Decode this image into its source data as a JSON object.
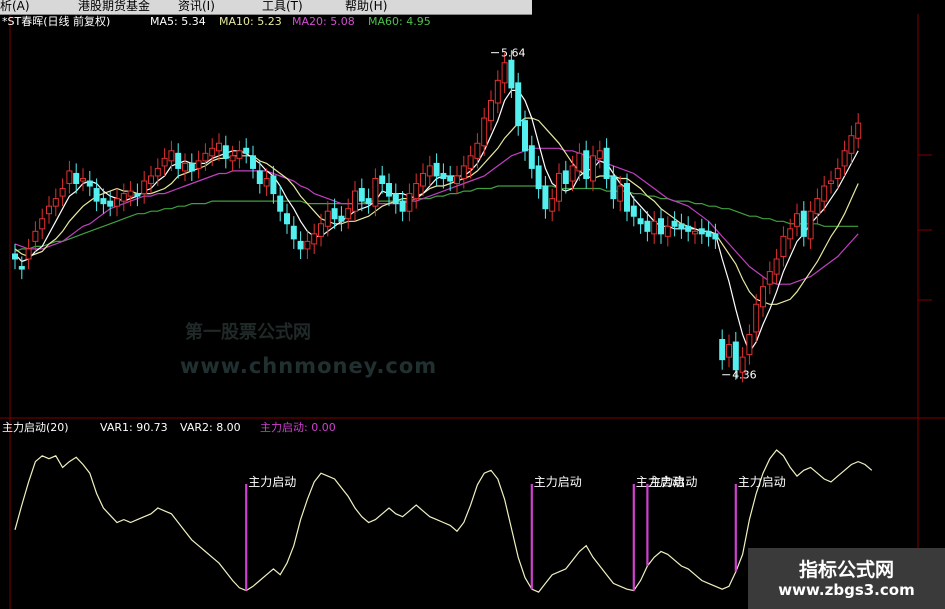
{
  "menu": {
    "items": [
      "析(A)",
      "港股期货基金",
      "资讯(I)",
      "工具(T)",
      "帮助(H)"
    ]
  },
  "header": {
    "stock": "*ST春晖(日线 前复权)",
    "ma5": "MA5: 5.34",
    "ma10": "MA10: 5.23",
    "ma20": "MA20: 5.08",
    "ma60": "MA60: 4.95"
  },
  "indicator_header": {
    "name": "主力启动(20)",
    "var1": "VAR1: 90.73",
    "var2": "VAR2: 8.00",
    "signal": "主力启动: 0.00"
  },
  "watermark": {
    "line1": "第一股票公式网",
    "line2": "www.chnmoney.com"
  },
  "badge": {
    "line1": "指标公式网",
    "line2": "www.zbgs3.com"
  },
  "colors": {
    "up": "#e03030",
    "down": "#54f0f0",
    "ma5": "#ffffff",
    "ma10": "#e8e8a0",
    "ma20": "#c040c0",
    "ma60": "#40a040",
    "signal": "#d040d0",
    "indicator_line": "#f0f0c0",
    "frame": "#800000"
  },
  "chart_data": [
    {
      "type": "candlestick",
      "title": "*ST春晖(日线 前复权)",
      "ylim": [
        4.2,
        5.75
      ],
      "annotations": [
        {
          "text": "5.64",
          "x_index": 70,
          "value": 5.64
        },
        {
          "text": "4.36",
          "x_index": 104,
          "value": 4.36
        }
      ],
      "series_ma": [
        {
          "name": "MA5",
          "last": 5.34
        },
        {
          "name": "MA10",
          "last": 5.23
        },
        {
          "name": "MA20",
          "last": 5.08
        },
        {
          "name": "MA60",
          "last": 4.95
        }
      ],
      "close": [
        4.82,
        4.78,
        4.86,
        4.93,
        4.98,
        5.03,
        5.06,
        5.1,
        5.17,
        5.12,
        5.14,
        5.11,
        5.05,
        5.04,
        5.03,
        5.06,
        5.08,
        5.09,
        5.07,
        5.13,
        5.15,
        5.18,
        5.22,
        5.25,
        5.18,
        5.2,
        5.17,
        5.21,
        5.24,
        5.26,
        5.28,
        5.22,
        5.23,
        5.25,
        5.24,
        5.18,
        5.12,
        5.14,
        5.08,
        5.01,
        4.96,
        4.9,
        4.86,
        4.89,
        4.92,
        4.96,
        5.01,
        4.98,
        4.97,
        5.02,
        5.09,
        5.05,
        5.04,
        5.14,
        5.12,
        5.07,
        5.04,
        5.01,
        5.08,
        5.12,
        5.16,
        5.19,
        5.15,
        5.14,
        5.13,
        5.15,
        5.19,
        5.23,
        5.28,
        5.38,
        5.45,
        5.53,
        5.6,
        5.5,
        5.35,
        5.25,
        5.18,
        5.1,
        5.02,
        5.06,
        5.16,
        5.12,
        5.19,
        5.24,
        5.14,
        5.23,
        5.25,
        5.14,
        5.06,
        5.11,
        5.01,
        4.99,
        4.96,
        4.93,
        4.97,
        4.92,
        4.95,
        4.95,
        4.94,
        4.93,
        4.93,
        4.92,
        4.91,
        4.9,
        4.42,
        4.48,
        4.38,
        4.43,
        4.52,
        4.64,
        4.71,
        4.77,
        4.82,
        4.91,
        4.94,
        5.0,
        4.91,
        5.01,
        5.06,
        5.11,
        5.13,
        5.18,
        5.25,
        5.31,
        5.36
      ],
      "open": [
        4.84,
        4.79,
        4.82,
        4.89,
        4.94,
        5.0,
        5.03,
        5.07,
        5.12,
        5.16,
        5.13,
        5.13,
        5.1,
        5.06,
        5.05,
        5.03,
        5.05,
        5.07,
        5.08,
        5.08,
        5.12,
        5.15,
        5.19,
        5.21,
        5.24,
        5.17,
        5.2,
        5.18,
        5.21,
        5.23,
        5.25,
        5.27,
        5.21,
        5.22,
        5.26,
        5.23,
        5.17,
        5.11,
        5.15,
        5.07,
        5.0,
        4.95,
        4.89,
        4.86,
        4.88,
        4.91,
        4.95,
        5.02,
        4.99,
        4.98,
        5.01,
        5.1,
        5.06,
        5.03,
        5.15,
        5.12,
        5.08,
        5.05,
        5.01,
        5.06,
        5.11,
        5.15,
        5.2,
        5.16,
        5.15,
        5.12,
        5.14,
        5.18,
        5.22,
        5.27,
        5.37,
        5.44,
        5.52,
        5.61,
        5.52,
        5.37,
        5.27,
        5.19,
        5.11,
        5.01,
        5.05,
        5.17,
        5.13,
        5.17,
        5.25,
        5.13,
        5.22,
        5.26,
        5.15,
        5.05,
        5.12,
        5.03,
        4.98,
        4.97,
        4.92,
        4.98,
        4.91,
        4.97,
        4.96,
        4.95,
        4.92,
        4.94,
        4.93,
        4.92,
        4.5,
        4.43,
        4.49,
        4.37,
        4.44,
        4.53,
        4.63,
        4.72,
        4.76,
        4.83,
        4.9,
        4.95,
        5.01,
        4.9,
        5.0,
        5.05,
        5.12,
        5.14,
        5.19,
        5.24,
        5.3
      ],
      "ma5": [
        4.84,
        4.81,
        4.82,
        4.85,
        4.87,
        4.92,
        4.97,
        5.02,
        5.07,
        5.09,
        5.12,
        5.13,
        5.12,
        5.09,
        5.07,
        5.06,
        5.05,
        5.06,
        5.07,
        5.09,
        5.1,
        5.13,
        5.15,
        5.19,
        5.2,
        5.21,
        5.2,
        5.2,
        5.2,
        5.22,
        5.23,
        5.24,
        5.25,
        5.25,
        5.24,
        5.22,
        5.2,
        5.17,
        5.15,
        5.11,
        5.06,
        5.02,
        4.97,
        4.93,
        4.91,
        4.91,
        4.93,
        4.95,
        4.97,
        4.99,
        5.01,
        5.02,
        5.03,
        5.05,
        5.09,
        5.08,
        5.08,
        5.08,
        5.07,
        5.06,
        5.08,
        5.11,
        5.14,
        5.15,
        5.15,
        5.15,
        5.15,
        5.17,
        5.2,
        5.25,
        5.31,
        5.37,
        5.45,
        5.49,
        5.49,
        5.45,
        5.38,
        5.28,
        5.18,
        5.12,
        5.1,
        5.09,
        5.1,
        5.15,
        5.17,
        5.18,
        5.21,
        5.2,
        5.16,
        5.12,
        5.1,
        5.06,
        5.03,
        5.0,
        4.97,
        4.95,
        4.95,
        4.94,
        4.94,
        4.94,
        4.94,
        4.93,
        4.93,
        4.92,
        4.82,
        4.73,
        4.62,
        4.52,
        4.45,
        4.49,
        4.56,
        4.62,
        4.69,
        4.77,
        4.83,
        4.89,
        4.92,
        4.96,
        4.99,
        5.02,
        5.06,
        5.1,
        5.15,
        5.2,
        5.25
      ],
      "ma10": [
        4.86,
        4.84,
        4.83,
        4.84,
        4.85,
        4.88,
        4.9,
        4.93,
        4.97,
        5.0,
        5.03,
        5.05,
        5.07,
        5.08,
        5.09,
        5.1,
        5.09,
        5.09,
        5.08,
        5.08,
        5.08,
        5.09,
        5.1,
        5.12,
        5.15,
        5.16,
        5.17,
        5.18,
        5.19,
        5.21,
        5.22,
        5.22,
        5.23,
        5.23,
        5.23,
        5.23,
        5.21,
        5.2,
        5.18,
        5.16,
        5.14,
        5.11,
        5.07,
        5.04,
        5.01,
        4.98,
        4.97,
        4.96,
        4.96,
        4.97,
        4.97,
        4.98,
        4.99,
        5.01,
        5.03,
        5.04,
        5.05,
        5.06,
        5.06,
        5.07,
        5.08,
        5.1,
        5.11,
        5.11,
        5.12,
        5.13,
        5.14,
        5.15,
        5.17,
        5.2,
        5.23,
        5.26,
        5.3,
        5.33,
        5.36,
        5.38,
        5.38,
        5.37,
        5.34,
        5.31,
        5.28,
        5.24,
        5.2,
        5.17,
        5.15,
        5.14,
        5.15,
        5.15,
        5.15,
        5.14,
        5.14,
        5.12,
        5.1,
        5.07,
        5.05,
        5.02,
        5.0,
        4.98,
        4.96,
        4.95,
        4.94,
        4.93,
        4.93,
        4.92,
        4.88,
        4.84,
        4.8,
        4.74,
        4.69,
        4.66,
        4.65,
        4.64,
        4.64,
        4.65,
        4.66,
        4.69,
        4.73,
        4.77,
        4.81,
        4.86,
        4.91,
        4.95,
        5.0,
        5.06,
        5.12
      ],
      "ma20": [
        4.88,
        4.87,
        4.86,
        4.86,
        4.86,
        4.87,
        4.88,
        4.89,
        4.91,
        4.93,
        4.95,
        4.96,
        4.98,
        5.0,
        5.02,
        5.03,
        5.04,
        5.05,
        5.06,
        5.07,
        5.07,
        5.08,
        5.08,
        5.09,
        5.1,
        5.11,
        5.12,
        5.13,
        5.14,
        5.15,
        5.16,
        5.16,
        5.17,
        5.17,
        5.17,
        5.17,
        5.17,
        5.17,
        5.16,
        5.15,
        5.14,
        5.13,
        5.11,
        5.1,
        5.08,
        5.07,
        5.06,
        5.05,
        5.04,
        5.04,
        5.04,
        5.04,
        5.04,
        5.04,
        5.04,
        5.04,
        5.04,
        5.04,
        5.05,
        5.05,
        5.06,
        5.07,
        5.08,
        5.09,
        5.1,
        5.11,
        5.12,
        5.13,
        5.14,
        5.15,
        5.17,
        5.19,
        5.21,
        5.23,
        5.24,
        5.25,
        5.26,
        5.26,
        5.26,
        5.26,
        5.26,
        5.25,
        5.25,
        5.24,
        5.23,
        5.22,
        5.21,
        5.2,
        5.19,
        5.18,
        5.17,
        5.16,
        5.14,
        5.12,
        5.1,
        5.08,
        5.06,
        5.05,
        5.04,
        5.03,
        5.01,
        4.99,
        4.97,
        4.94,
        4.91,
        4.88,
        4.85,
        4.82,
        4.79,
        4.77,
        4.75,
        4.73,
        4.72,
        4.72,
        4.72,
        4.73,
        4.74,
        4.75,
        4.77,
        4.79,
        4.81,
        4.83,
        4.86,
        4.89,
        4.92
      ],
      "ma60": [
        4.85,
        4.86,
        4.86,
        4.87,
        4.87,
        4.88,
        4.89,
        4.89,
        4.9,
        4.91,
        4.92,
        4.93,
        4.94,
        4.95,
        4.96,
        4.97,
        4.98,
        4.99,
        5.0,
        5.0,
        5.01,
        5.01,
        5.02,
        5.02,
        5.03,
        5.03,
        5.04,
        5.04,
        5.04,
        5.05,
        5.05,
        5.05,
        5.05,
        5.05,
        5.05,
        5.05,
        5.05,
        5.05,
        5.05,
        5.05,
        5.05,
        5.05,
        5.05,
        5.04,
        5.04,
        5.04,
        5.04,
        5.04,
        5.04,
        5.04,
        5.04,
        5.04,
        5.05,
        5.05,
        5.05,
        5.05,
        5.05,
        5.05,
        5.05,
        5.06,
        5.06,
        5.06,
        5.07,
        5.07,
        5.08,
        5.08,
        5.09,
        5.09,
        5.1,
        5.1,
        5.1,
        5.11,
        5.11,
        5.11,
        5.11,
        5.11,
        5.11,
        5.11,
        5.11,
        5.11,
        5.1,
        5.1,
        5.1,
        5.1,
        5.1,
        5.1,
        5.1,
        5.09,
        5.09,
        5.09,
        5.09,
        5.08,
        5.08,
        5.07,
        5.07,
        5.06,
        5.06,
        5.05,
        5.05,
        5.05,
        5.04,
        5.04,
        5.03,
        5.03,
        5.02,
        5.02,
        5.01,
        5.0,
        4.99,
        4.99,
        4.98,
        4.98,
        4.97,
        4.97,
        4.96,
        4.96,
        4.96,
        4.96,
        4.96,
        4.95,
        4.95,
        4.95,
        4.95,
        4.95,
        4.95
      ]
    },
    {
      "type": "line",
      "title": "主力启动(20)",
      "ylim": [
        0,
        100
      ],
      "series": [
        {
          "name": "VAR1",
          "values": [
            45,
            62,
            78,
            92,
            96,
            94,
            96,
            88,
            92,
            95,
            90,
            84,
            70,
            60,
            55,
            50,
            52,
            50,
            52,
            54,
            56,
            60,
            58,
            56,
            50,
            44,
            38,
            34,
            30,
            26,
            22,
            16,
            10,
            5,
            3,
            6,
            10,
            14,
            18,
            14,
            22,
            34,
            52,
            66,
            78,
            84,
            82,
            80,
            74,
            68,
            60,
            54,
            50,
            52,
            56,
            60,
            56,
            54,
            58,
            62,
            58,
            54,
            52,
            50,
            48,
            44,
            50,
            62,
            76,
            84,
            86,
            80,
            66,
            46,
            26,
            12,
            4,
            2,
            8,
            14,
            16,
            18,
            24,
            30,
            34,
            26,
            20,
            14,
            8,
            6,
            4,
            3,
            10,
            20,
            26,
            30,
            28,
            24,
            20,
            18,
            14,
            10,
            8,
            6,
            4,
            6,
            16,
            28,
            52,
            70,
            84,
            94,
            100,
            96,
            88,
            82,
            86,
            88,
            84,
            80,
            78,
            82,
            86,
            90,
            92,
            90,
            86
          ]
        }
      ],
      "signal_name": "主力启动",
      "signal_indices": [
        34,
        76,
        91,
        93,
        106
      ],
      "signal_labels": [
        "主力启动",
        "主力启动",
        "主力启动",
        "主力启动",
        "主力启动"
      ]
    }
  ]
}
